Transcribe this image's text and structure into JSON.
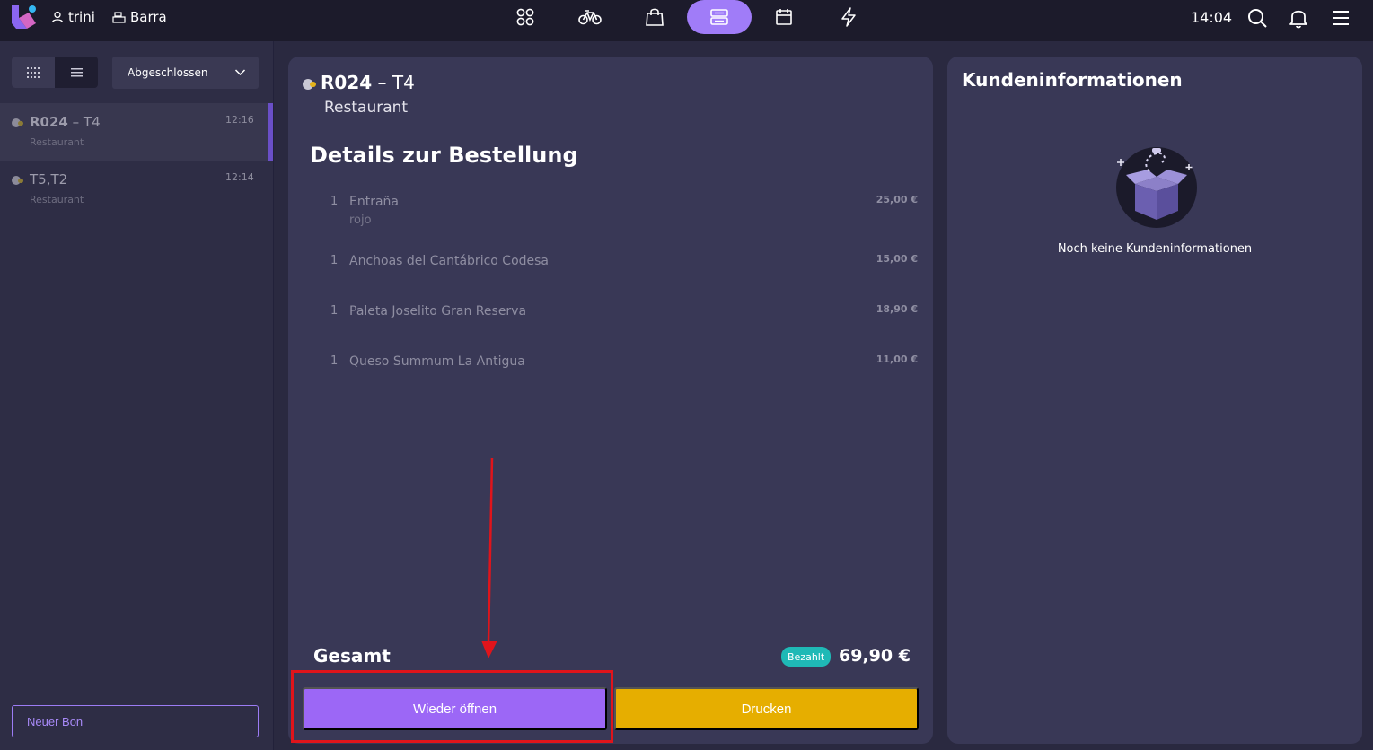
{
  "topbar": {
    "user_name": "trini",
    "location": "Barra",
    "time": "14:04",
    "nav_items": [
      "apps-icon",
      "bike-icon",
      "shopping-bag-icon",
      "orders-icon",
      "calendar-icon",
      "lightning-icon"
    ],
    "active_nav": "orders-icon"
  },
  "sidebar": {
    "status_filter": "Abgeschlossen",
    "orders": [
      {
        "code": "R024",
        "table": " – T4",
        "subtitle": "Restaurant",
        "time": "12:16",
        "selected": true
      },
      {
        "code": "",
        "table": "T5,T2",
        "subtitle": "Restaurant",
        "time": "12:14",
        "selected": false
      }
    ],
    "new_bon_label": "Neuer Bon"
  },
  "order": {
    "code": "R024",
    "table": " – T4",
    "subtitle": "Restaurant",
    "details_heading": "Details zur Bestellung",
    "items": [
      {
        "qty": "1",
        "name": "Entraña",
        "note": "rojo",
        "price": "25,00 €"
      },
      {
        "qty": "1",
        "name": "Anchoas del Cantábrico Codesa",
        "note": "",
        "price": "15,00 €"
      },
      {
        "qty": "1",
        "name": "Paleta Joselito Gran Reserva",
        "note": "",
        "price": "18,90 €"
      },
      {
        "qty": "1",
        "name": "Queso Summum La Antigua",
        "note": "",
        "price": "11,00 €"
      }
    ],
    "total_label": "Gesamt",
    "paid_badge": "Bezahlt",
    "total_amount": "69,90 €",
    "reopen_label": "Wieder öffnen",
    "print_label": "Drucken"
  },
  "customer": {
    "heading": "Kundeninformationen",
    "empty_text": "Noch keine Kundeninformationen"
  },
  "colors": {
    "accent": "#a07cf8",
    "reopen": "#9c67f6",
    "print": "#e6ae00",
    "paid": "#1fb9b6",
    "annotation": "#e0141b"
  }
}
